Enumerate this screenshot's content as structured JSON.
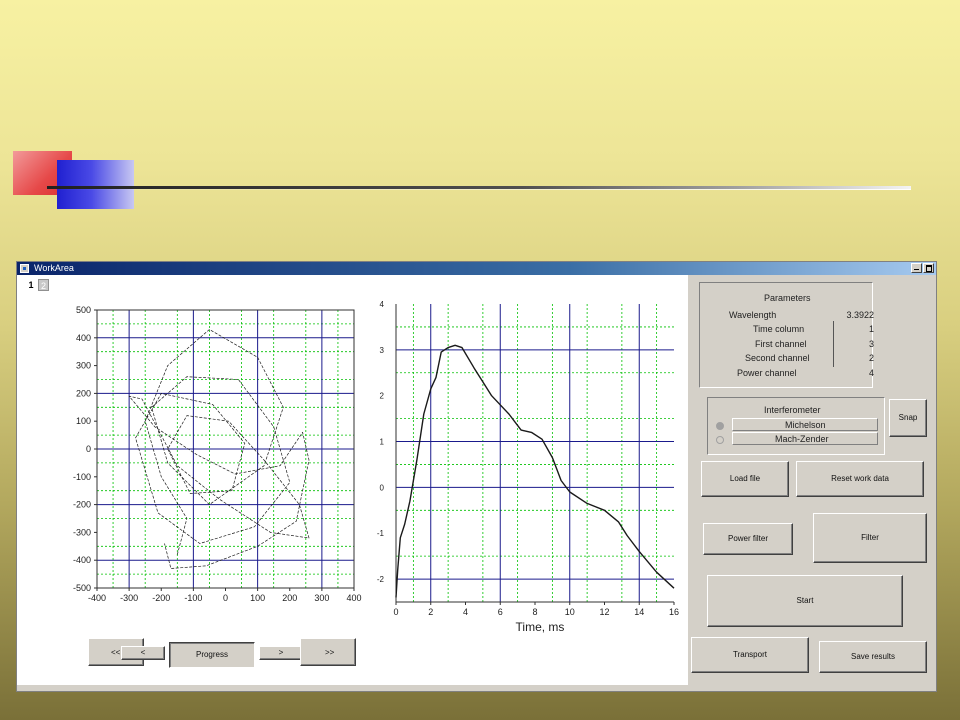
{
  "window": {
    "title": "WorkArea",
    "tabs": [
      "1",
      "2"
    ]
  },
  "colors": {
    "accent_red": "#e64848",
    "accent_blue": "#2020d0",
    "plot_line": "#1a1a1a",
    "grid_major": "#1a1a8c",
    "grid_minor": "#00c000"
  },
  "icons": {
    "window_icon": "app-window-icon",
    "minimize": "minimize-icon",
    "maximize": "maximize-icon"
  },
  "chart_data": [
    {
      "type": "line",
      "description_hidden": true,
      "x_ticks": [
        "-400",
        "-300",
        "-200",
        "-100",
        "0",
        "100",
        "200",
        "300",
        "400"
      ],
      "y_ticks": [
        "500",
        "400",
        "300",
        "200",
        "100",
        "0",
        "-100",
        "-200",
        "-300",
        "-400",
        "-500"
      ],
      "xlim": [
        -400,
        400
      ],
      "ylim": [
        -500,
        500
      ],
      "xlabel": "",
      "ylabel": "",
      "grid": true
    },
    {
      "type": "line",
      "x_ticks": [
        "0",
        "2",
        "4",
        "6",
        "8",
        "10",
        "12",
        "14",
        "16"
      ],
      "y_ticks": [
        "4",
        "3",
        "2",
        "1",
        "0",
        "-1",
        "-2"
      ],
      "xlim": [
        0,
        16
      ],
      "ylim": [
        -2.5,
        4
      ],
      "xlabel": "Time, ms",
      "ylabel": "",
      "grid": true,
      "series": [
        {
          "x": [
            0,
            0.1,
            0.25,
            0.5,
            0.8,
            1.2,
            1.6,
            2.0,
            2.3,
            2.6,
            3.0,
            3.4,
            3.8,
            4.5,
            5.5,
            6.5,
            7.2,
            7.8,
            8.4,
            9.0,
            9.5,
            10.0,
            11.0,
            12.0,
            12.8,
            13.3,
            14.0,
            15.0,
            16.0
          ],
          "y": [
            -2.4,
            -1.8,
            -1.1,
            -0.8,
            -0.3,
            0.6,
            1.6,
            2.15,
            2.4,
            2.95,
            3.05,
            3.1,
            3.05,
            2.6,
            2.0,
            1.6,
            1.25,
            1.2,
            1.05,
            0.65,
            0.15,
            -0.1,
            -0.35,
            -0.5,
            -0.75,
            -1.05,
            -1.4,
            -1.85,
            -2.2
          ]
        }
      ]
    }
  ],
  "playback": {
    "prev_label": "<<",
    "slider1_label": "<",
    "progress_label": "Progress",
    "slider2_label": ">",
    "next_label": ">>"
  },
  "parameters": {
    "title": "Parameters",
    "rows": [
      {
        "label": "Wavelength",
        "value": "3.3922"
      },
      {
        "label": "Time column",
        "value": "1"
      },
      {
        "label": "First channel",
        "value": "3"
      },
      {
        "label": "Second channel",
        "value": "2"
      },
      {
        "label": "Power channel",
        "value": "4"
      }
    ]
  },
  "interferometer": {
    "title": "Interferometer",
    "options": [
      "Michelson",
      "Mach-Zender"
    ],
    "selected": "Michelson",
    "side_button": "Snap"
  },
  "buttons": {
    "load_file": "Load file",
    "reset_work_data": "Reset work data",
    "power_filter": "Power filter",
    "filter": "Filter",
    "start": "Start",
    "transport": "Transport",
    "save_results": "Save results"
  }
}
